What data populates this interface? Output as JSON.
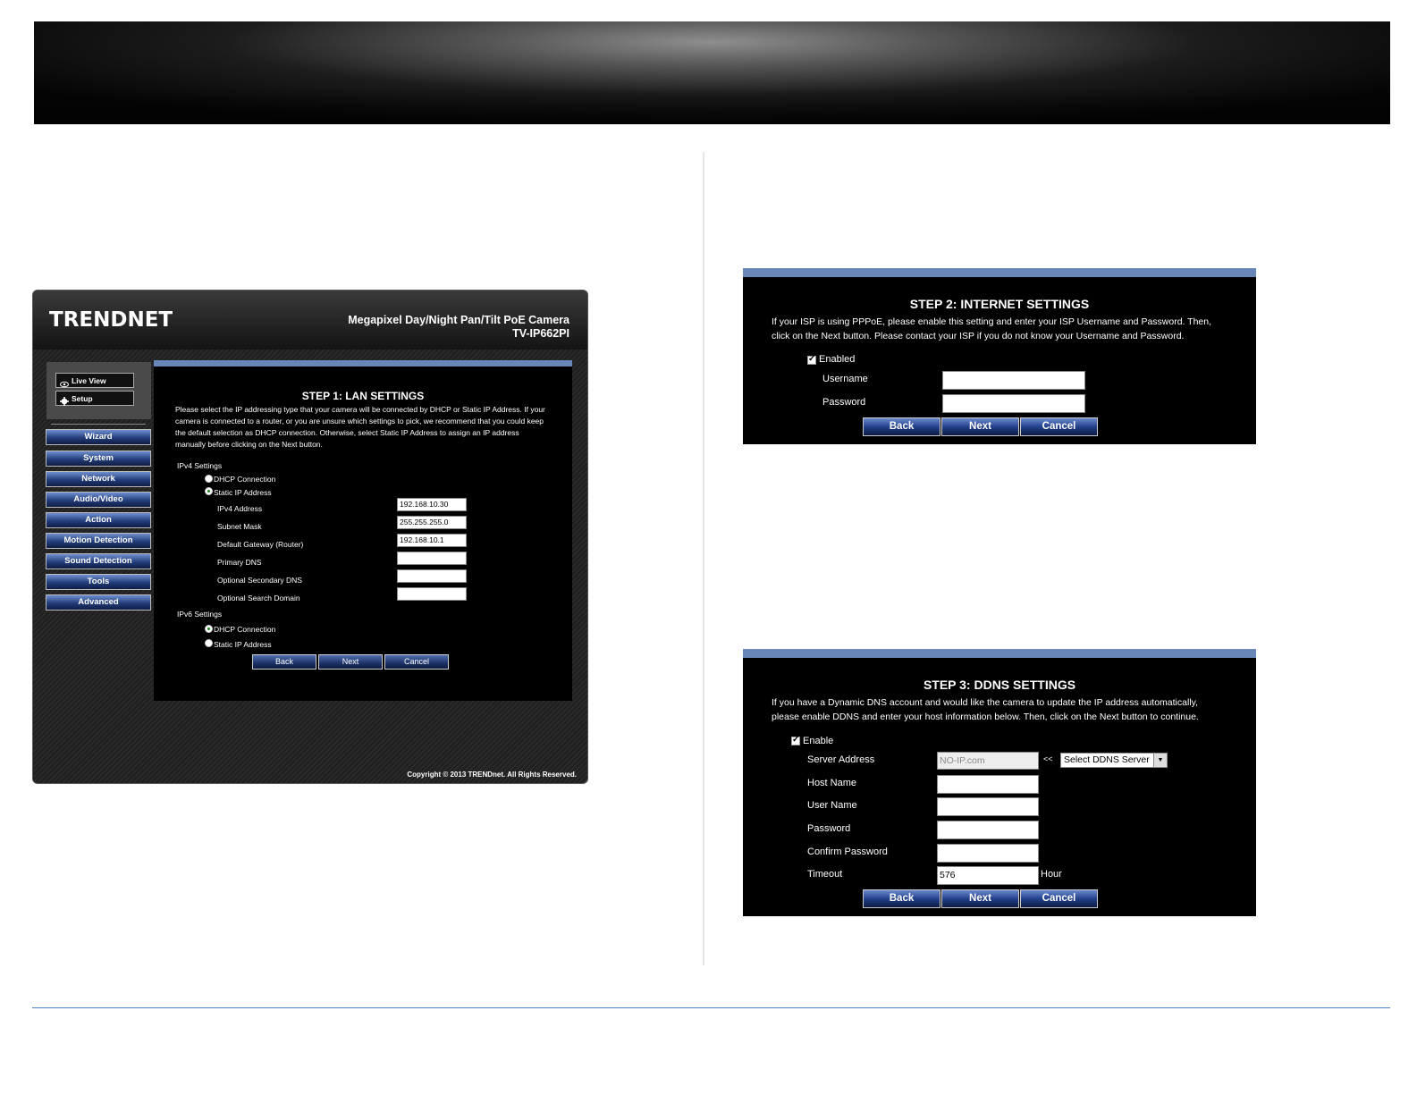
{
  "camera_ui": {
    "logo": "TRENDNET",
    "title_line1": "Megapixel Day/Night Pan/Tilt PoE Camera",
    "title_line2": "TV-IP662PI",
    "top_buttons": [
      "Live View",
      "Setup"
    ],
    "nav": [
      "Wizard",
      "System",
      "Network",
      "Audio/Video",
      "Action",
      "Motion Detection",
      "Sound Detection",
      "Tools",
      "Advanced"
    ],
    "step_title": "STEP 1: LAN SETTINGS",
    "description": "Please select the IP addressing type that your camera will be connected by DHCP or Static IP Address. If your camera is connected to a router, or you are unsure which settings to pick, we recommend that you could keep the default selection as DHCP connection. Otherwise, select Static IP Address to assign an IP address manually before clicking on the Next button.",
    "ipv4_heading": "IPv4 Settings",
    "ipv4_dhcp": "DHCP Connection",
    "ipv4_static": "Static IP Address",
    "fields": {
      "ipv4_address": {
        "label": "IPv4 Address",
        "value": "192.168.10.30"
      },
      "subnet_mask": {
        "label": "Subnet Mask",
        "value": "255.255.255.0"
      },
      "gateway": {
        "label": "Default Gateway (Router)",
        "value": "192.168.10.1"
      },
      "primary_dns": {
        "label": "Primary DNS",
        "value": ""
      },
      "secondary_dns": {
        "label": "Optional Secondary DNS",
        "value": ""
      },
      "search_domain": {
        "label": "Optional Search Domain",
        "value": ""
      }
    },
    "ipv6_heading": "IPv6 Settings",
    "ipv6_dhcp": "DHCP Connection",
    "ipv6_static": "Static IP Address",
    "buttons": {
      "back": "Back",
      "next": "Next",
      "cancel": "Cancel"
    },
    "copyright": "Copyright © 2013 TRENDnet. All Rights Reserved."
  },
  "step2": {
    "title": "STEP 2: INTERNET SETTINGS",
    "desc_line1": "If your ISP is using PPPoE, please enable this setting and enter your ISP Username and Password. Then,",
    "desc_line2": "click on the Next button. Please contact your ISP if you do not know your Username and Password.",
    "enabled_label": "Enabled",
    "enabled_checked": true,
    "username_label": "Username",
    "username_value": "",
    "password_label": "Password",
    "password_value": "",
    "buttons": {
      "back": "Back",
      "next": "Next",
      "cancel": "Cancel"
    }
  },
  "step3": {
    "title": "STEP 3: DDNS SETTINGS",
    "desc_line1": "If you have a Dynamic DNS account and would like the camera to update the IP address automatically,",
    "desc_line2": "please enable DDNS and enter your host information below. Then, click on the Next button to continue.",
    "enable_label": "Enable",
    "enable_checked": true,
    "server_label": "Server Address",
    "server_value": "NO-IP.com",
    "arrow_text": "<<",
    "server_select": "Select DDNS Server",
    "host_label": "Host Name",
    "user_label": "User Name",
    "password_label": "Password",
    "confirm_label": "Confirm Password",
    "timeout_label": "Timeout",
    "timeout_value": "576",
    "timeout_unit": "Hour",
    "buttons": {
      "back": "Back",
      "next": "Next",
      "cancel": "Cancel"
    }
  },
  "colors": {
    "panel_header": "#6886b8",
    "page_rule": "#4f81bd",
    "nav_button": "#23408a"
  }
}
